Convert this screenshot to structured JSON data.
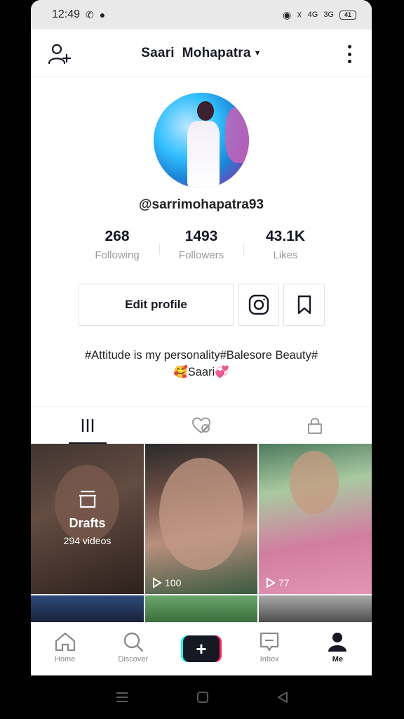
{
  "status_bar": {
    "time": "12:49",
    "network": "4G",
    "network2": "3G",
    "battery": "41"
  },
  "header": {
    "title": "Saari  Mohapatra"
  },
  "profile": {
    "handle": "@sarrimohapatra93",
    "stats": [
      {
        "value": "268",
        "label": "Following"
      },
      {
        "value": "1493",
        "label": "Followers"
      },
      {
        "value": "43.1K",
        "label": "Likes"
      }
    ],
    "edit_button": "Edit profile",
    "bio_line1": "#Attitude is my personality#Balesore Beauty#",
    "bio_line2": "🥰Saari💞"
  },
  "grid": {
    "drafts_title": "Drafts",
    "drafts_count": "294 videos",
    "tile2_views": "100",
    "tile3_views": "77"
  },
  "bottom_nav": {
    "home": "Home",
    "discover": "Discover",
    "create": "+",
    "inbox": "Inbox",
    "me": "Me"
  }
}
